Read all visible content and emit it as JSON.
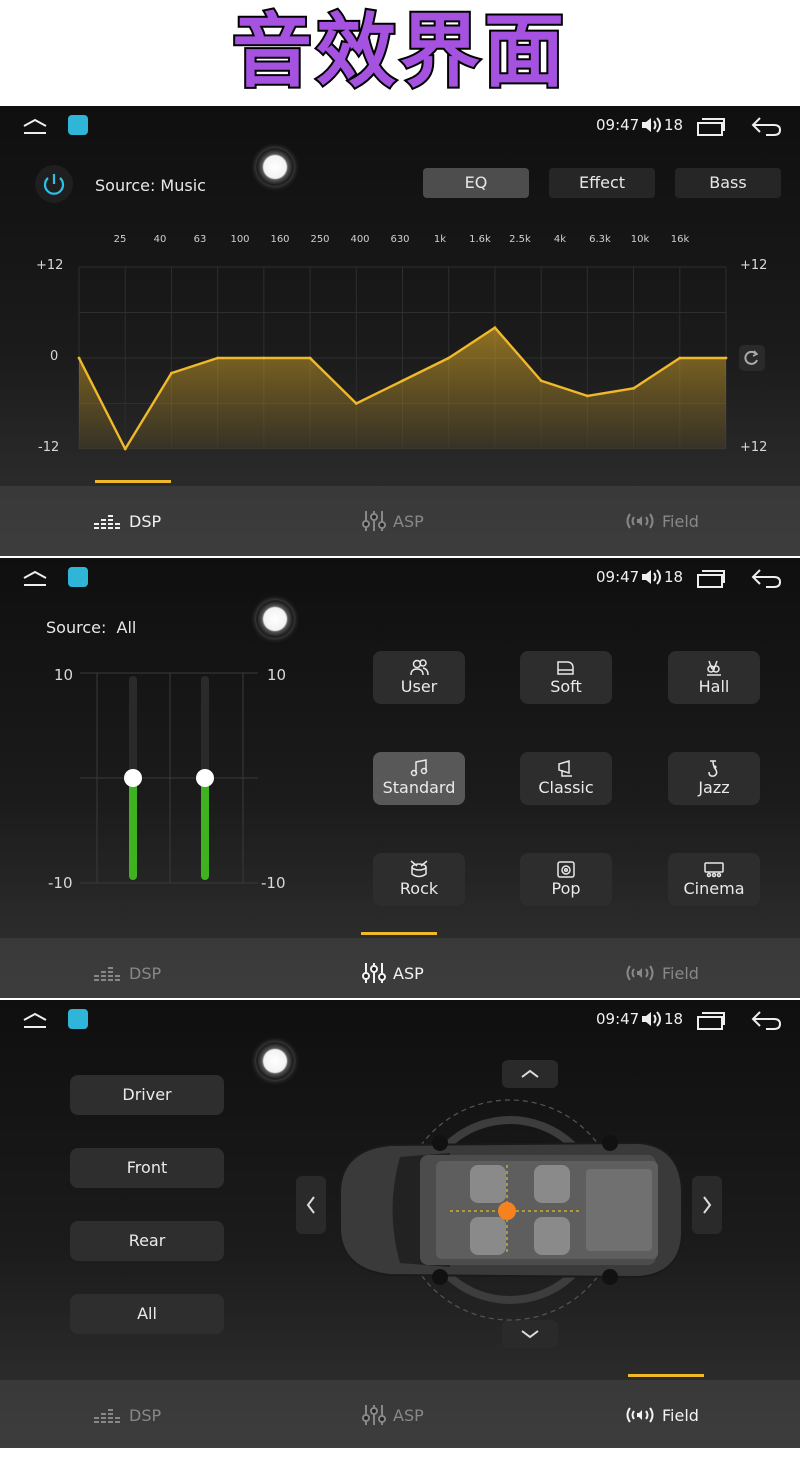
{
  "banner": {
    "title": "音效界面"
  },
  "status": {
    "time": "09:47",
    "volume": "18"
  },
  "dsp": {
    "source_label": "Source: Music",
    "tabs": [
      "EQ",
      "Effect",
      "Bass"
    ],
    "active_tab": "EQ",
    "freqs": [
      "25",
      "40",
      "63",
      "100",
      "160",
      "250",
      "400",
      "630",
      "1k",
      "1.6k",
      "2.5k",
      "4k",
      "6.3k",
      "10k",
      "16k"
    ],
    "y_left": [
      "+12",
      "0",
      "-12"
    ],
    "y_right": [
      "+12",
      "+12"
    ],
    "accent_color": "#f0b92a"
  },
  "chart_data": {
    "type": "area",
    "x": [
      "",
      "25",
      "40",
      "63",
      "100",
      "160",
      "250",
      "400",
      "630",
      "1k",
      "1.6k",
      "2.5k",
      "4k",
      "6.3k",
      "10k",
      "16k"
    ],
    "values": [
      0,
      -12,
      -2,
      0,
      0,
      0,
      -6,
      -3,
      0,
      4,
      -3,
      -5,
      -4,
      0,
      0
    ],
    "ylim": [
      -12,
      12
    ]
  },
  "asp": {
    "source_label": "Source:  All",
    "scale_top": "10",
    "scale_bottom": "-10",
    "sliders": [
      0,
      0
    ],
    "presets": [
      {
        "label": "User",
        "icon": "user-icon"
      },
      {
        "label": "Soft",
        "icon": "piano-icon"
      },
      {
        "label": "Hall",
        "icon": "hall-icon"
      },
      {
        "label": "Standard",
        "icon": "music-note-icon"
      },
      {
        "label": "Classic",
        "icon": "gramophone-icon"
      },
      {
        "label": "Jazz",
        "icon": "saxophone-icon"
      },
      {
        "label": "Rock",
        "icon": "drum-icon"
      },
      {
        "label": "Pop",
        "icon": "speaker-icon"
      },
      {
        "label": "Cinema",
        "icon": "cinema-icon"
      }
    ],
    "active_preset": "Standard"
  },
  "field": {
    "zones": [
      "Driver",
      "Front",
      "Rear",
      "All"
    ],
    "focus_color": "#f5821f"
  },
  "bottom_tabs": [
    "DSP",
    "ASP",
    "Field"
  ]
}
